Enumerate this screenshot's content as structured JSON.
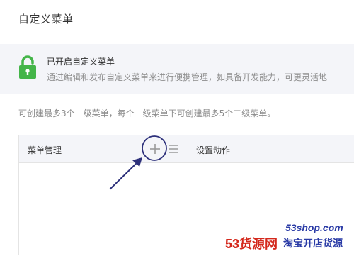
{
  "page": {
    "title": "自定义菜单"
  },
  "status": {
    "title": "已开启自定义菜单",
    "description": "通过编辑和发布自定义菜单来进行便携管理，如具备开发能力，可更灵活地",
    "icon": "lock-open-icon",
    "icon_color": "#44b549"
  },
  "limit_note": "可创建最多3个一级菜单，每个一级菜单下可创建最多5个二级菜单。",
  "table": {
    "menu_manage_label": "菜单管理",
    "action_label": "设置动作",
    "add_icon": "plus-icon",
    "list_icon": "list-icon"
  },
  "watermark": {
    "url": "53shop.com",
    "brand": "53货源网",
    "slogan": "淘宝开店货源"
  }
}
